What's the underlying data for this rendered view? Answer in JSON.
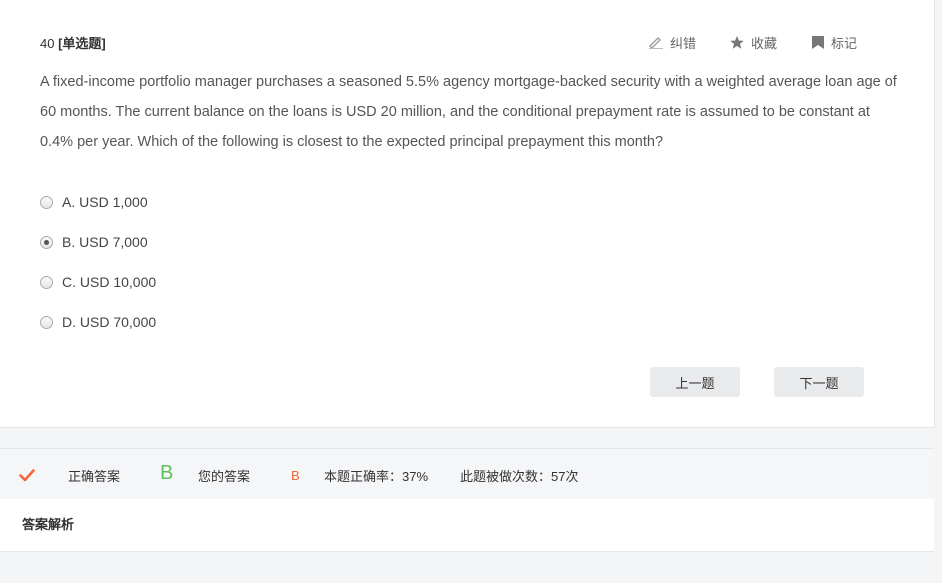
{
  "question": {
    "number": "40",
    "type": "[单选题]",
    "text": "A fixed-income portfolio manager purchases a seasoned 5.5% agency mortgage-backed security with a weighted average loan age of 60 months. The current balance on the loans is USD 20 million, and the conditional prepayment rate is assumed to be constant at 0.4% per year. Which of the following is closest to the expected principal prepayment this month?"
  },
  "tools": {
    "report_error": "纠错",
    "favorite": "收藏",
    "mark": "标记"
  },
  "options": [
    {
      "label": "A. USD 1,000",
      "selected": false
    },
    {
      "label": "B. USD 7,000",
      "selected": true
    },
    {
      "label": "C. USD 10,000",
      "selected": false
    },
    {
      "label": "D. USD 70,000",
      "selected": false
    }
  ],
  "nav": {
    "prev": "上一题",
    "next": "下一题"
  },
  "result": {
    "correct_label": "正确答案",
    "correct_answer": "B",
    "your_label": "您的答案",
    "your_answer": "B",
    "accuracy": "本题正确率：37%",
    "attempts": "此题被做次数：57次"
  },
  "analysis": {
    "title": "答案解析"
  },
  "colors": {
    "correct_green": "#5cc25c",
    "your_orange": "#f5673b",
    "check_orange": "#f5673b"
  }
}
